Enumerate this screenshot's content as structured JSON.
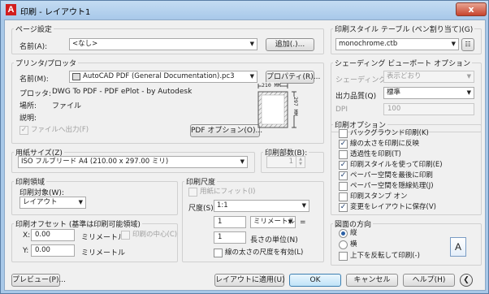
{
  "window": {
    "title": "印刷 - レイアウト1",
    "app_icon": "A",
    "close": "x"
  },
  "page_setup": {
    "group_label": "ページ設定",
    "name_label": "名前(A):",
    "name_value": "<なし>",
    "add_button": "追加(.)..."
  },
  "printer": {
    "group_label": "プリンタ/プロッタ",
    "name_label": "名前(M):",
    "name_value": "AutoCAD PDF (General Documentation).pc3",
    "properties_button": "プロパティ(R)...",
    "plotter_label": "プロッタ:",
    "plotter_value": "DWG To PDF - PDF ePlot - by Autodesk",
    "location_label": "場所:",
    "location_value": "ファイル",
    "description_label": "説明:",
    "print_to_file_label": "ファイルへ出力(F)",
    "pdf_options_button": "PDF オプション(O)...",
    "preview_width": "210 MM",
    "preview_height": "297 MM"
  },
  "paper_size": {
    "group_label": "用紙サイズ(Z)",
    "value": "ISO フルブリード A4 (210.00 x 297.00 ミリ)"
  },
  "copies": {
    "label": "印刷部数(B):",
    "value": "1"
  },
  "plot_area": {
    "group_label": "印刷領域",
    "target_label": "印刷対象(W):",
    "target_value": "レイアウト"
  },
  "plot_offset": {
    "group_label": "印刷オフセット (基準は印刷可能領域)",
    "x_label": "X:",
    "x_value": "0.00",
    "x_unit": "ミリメートル",
    "y_label": "Y:",
    "y_value": "0.00",
    "y_unit": "ミリメートル",
    "center_label": "印刷の中心(C)"
  },
  "plot_scale": {
    "group_label": "印刷尺度",
    "fit_label": "用紙にフィット(I)",
    "scale_label": "尺度(S):",
    "scale_value": "1:1",
    "value1": "1",
    "unit_value": "ミリメートル",
    "equals": "=",
    "value2": "1",
    "units_label": "長さの単位(N)",
    "lineweight_scale_label": "線の太さの尺度を有効(L)"
  },
  "plot_style_table": {
    "group_label": "印刷スタイル テーブル (ペン割り当て)(G)",
    "value": "monochrome.ctb"
  },
  "shaded_viewport": {
    "group_label": "シェーディング ビューポート オプション",
    "shading_label": "シェーディング(D)",
    "shading_value": "表示どおり",
    "quality_label": "出力品質(Q)",
    "quality_value": "標準",
    "dpi_label": "DPI",
    "dpi_value": "100"
  },
  "plot_options": {
    "group_label": "印刷オプション",
    "items": [
      {
        "label": "バックグラウンド印刷(K)",
        "checked": ""
      },
      {
        "label": "線の太さを印刷に反映",
        "checked": "✓"
      },
      {
        "label": "透過性を印刷(T)",
        "checked": ""
      },
      {
        "label": "印刷スタイルを使って印刷(E)",
        "checked": "✓"
      },
      {
        "label": "ペーパー空間を最後に印刷",
        "checked": "✓"
      },
      {
        "label": "ペーパー空間を隠線処理(J)",
        "checked": ""
      },
      {
        "label": "印刷スタンプ オン",
        "checked": ""
      },
      {
        "label": "変更をレイアウトに保存(V)",
        "checked": "✓"
      }
    ]
  },
  "orientation": {
    "group_label": "図面の方向",
    "portrait_label": "縦",
    "landscape_label": "横",
    "upside_down_label": "上下を反転して印刷(-)",
    "icon_letter": "A"
  },
  "footer": {
    "preview_button": "プレビュー(P)...",
    "apply_button": "レイアウトに適用(U)",
    "ok_button": "OK",
    "cancel_button": "キャンセル",
    "help_button": "ヘルプ(H)"
  }
}
